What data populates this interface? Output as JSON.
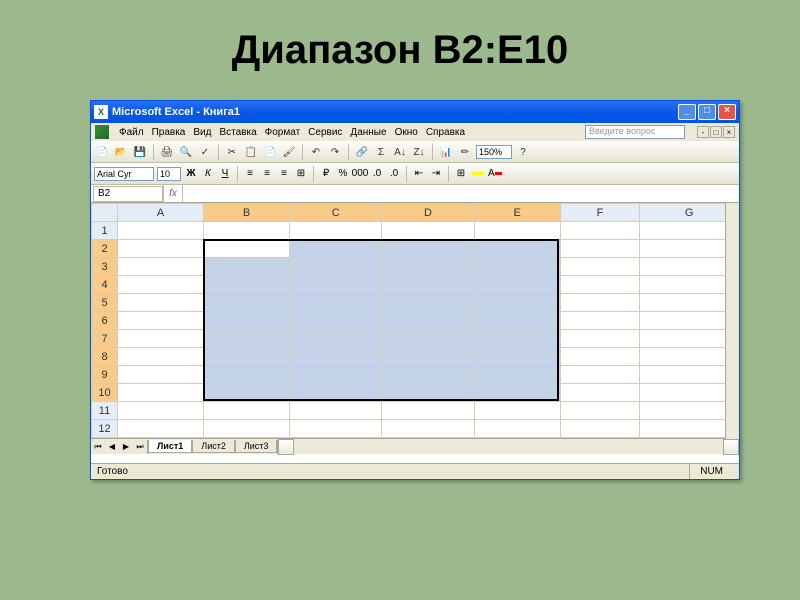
{
  "slide": {
    "title": "Диапазон B2:E10"
  },
  "window": {
    "title": "Microsoft Excel - Книга1"
  },
  "menu": {
    "file": "Файл",
    "edit": "Правка",
    "view": "Вид",
    "insert": "Вставка",
    "format": "Формат",
    "tools": "Сервис",
    "data": "Данные",
    "window": "Окно",
    "help": "Справка"
  },
  "helpbox": {
    "placeholder": "Введите вопрос"
  },
  "toolbar": {
    "zoom": "150%"
  },
  "format": {
    "font": "Arial Cyr",
    "size": "10",
    "bold": "Ж",
    "italic": "К",
    "underline": "Ч"
  },
  "namebox": {
    "value": "B2"
  },
  "fx": {
    "label": "fx"
  },
  "columns": [
    "A",
    "B",
    "C",
    "D",
    "E",
    "F",
    "G"
  ],
  "rows": [
    "1",
    "2",
    "3",
    "4",
    "5",
    "6",
    "7",
    "8",
    "9",
    "10",
    "11",
    "12"
  ],
  "selection": {
    "first_col": "B",
    "last_col": "E",
    "first_row": "2",
    "last_row": "10",
    "sel_col_indices": [
      1,
      2,
      3,
      4
    ],
    "sel_row_indices": [
      1,
      2,
      3,
      4,
      5,
      6,
      7,
      8,
      9
    ]
  },
  "tabs": {
    "sheet1": "Лист1",
    "sheet2": "Лист2",
    "sheet3": "Лист3"
  },
  "status": {
    "ready": "Готово",
    "num": "NUM"
  }
}
